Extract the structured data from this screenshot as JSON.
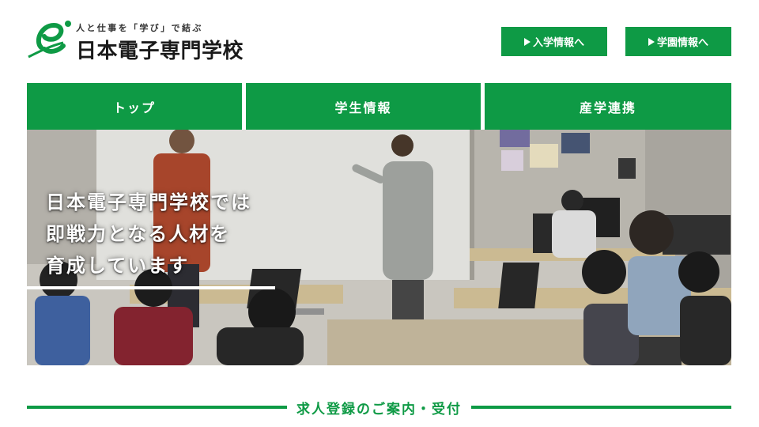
{
  "header": {
    "tagline": "人と仕事を「学び」で結ぶ",
    "school_name": "日本電子専門学校",
    "buttons": {
      "admission": "入学情報へ",
      "campus": "学園情報へ"
    }
  },
  "nav": {
    "items": [
      {
        "label": "トップ"
      },
      {
        "label": "学生情報"
      },
      {
        "label": "産学連携"
      }
    ]
  },
  "hero": {
    "lines": [
      "日本電子専門学校では",
      "即戦力となる人材を",
      "育成しています"
    ]
  },
  "section": {
    "title": "求人登録のご案内・受付"
  },
  "colors": {
    "brand_green": "#0e9a45",
    "white": "#ffffff"
  },
  "icons": {
    "logo": "e-leaf-logo-icon",
    "button_arrow": "triangle-right-icon"
  }
}
